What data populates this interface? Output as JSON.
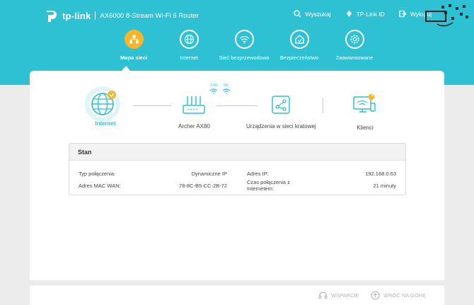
{
  "brand": {
    "logo": "tp-link",
    "model": "AX6000 8-Stream Wi-Fi 6 Router"
  },
  "top_links": {
    "search": "Wyszukaj",
    "tplink_id": "TP-Link ID",
    "logout": "Wyloguj"
  },
  "nav": [
    {
      "label": "Mapa sieci",
      "icon": "network-map-icon",
      "active": true
    },
    {
      "label": "Internet",
      "icon": "globe-icon",
      "active": false
    },
    {
      "label": "Sieć bezprzewodowa",
      "icon": "wifi-icon",
      "active": false
    },
    {
      "label": "Bezpieczeństwo",
      "icon": "shield-home-icon",
      "active": false
    },
    {
      "label": "Zaawansowane",
      "icon": "gear-icon",
      "active": false
    }
  ],
  "topology": {
    "internet": "Internet",
    "router": "Archer AX80",
    "band_24": "2,4G",
    "band_5": "5G",
    "mesh": "Urządzenia w sieci kratowej",
    "clients": "Klienci",
    "clients_badge": "1"
  },
  "status": {
    "title": "Stan",
    "conn_type_label": "Typ połączenia:",
    "conn_type_value": "Dynamiczne IP",
    "mac_label": "Adres MAC WAN:",
    "mac_value": "78-8C-B5-CC-2B-72",
    "ip_label": "Adres IP:",
    "ip_value": "192.168.0.63",
    "time_label": "Czas połączenia z Internetem:",
    "time_value": "21 minuty"
  },
  "footer": {
    "support": "WSPARCIE",
    "back_to_top": "WRÓĆ NA GÓRĘ"
  },
  "colors": {
    "accent": "#2ec1d3",
    "active": "#f7b52c"
  }
}
